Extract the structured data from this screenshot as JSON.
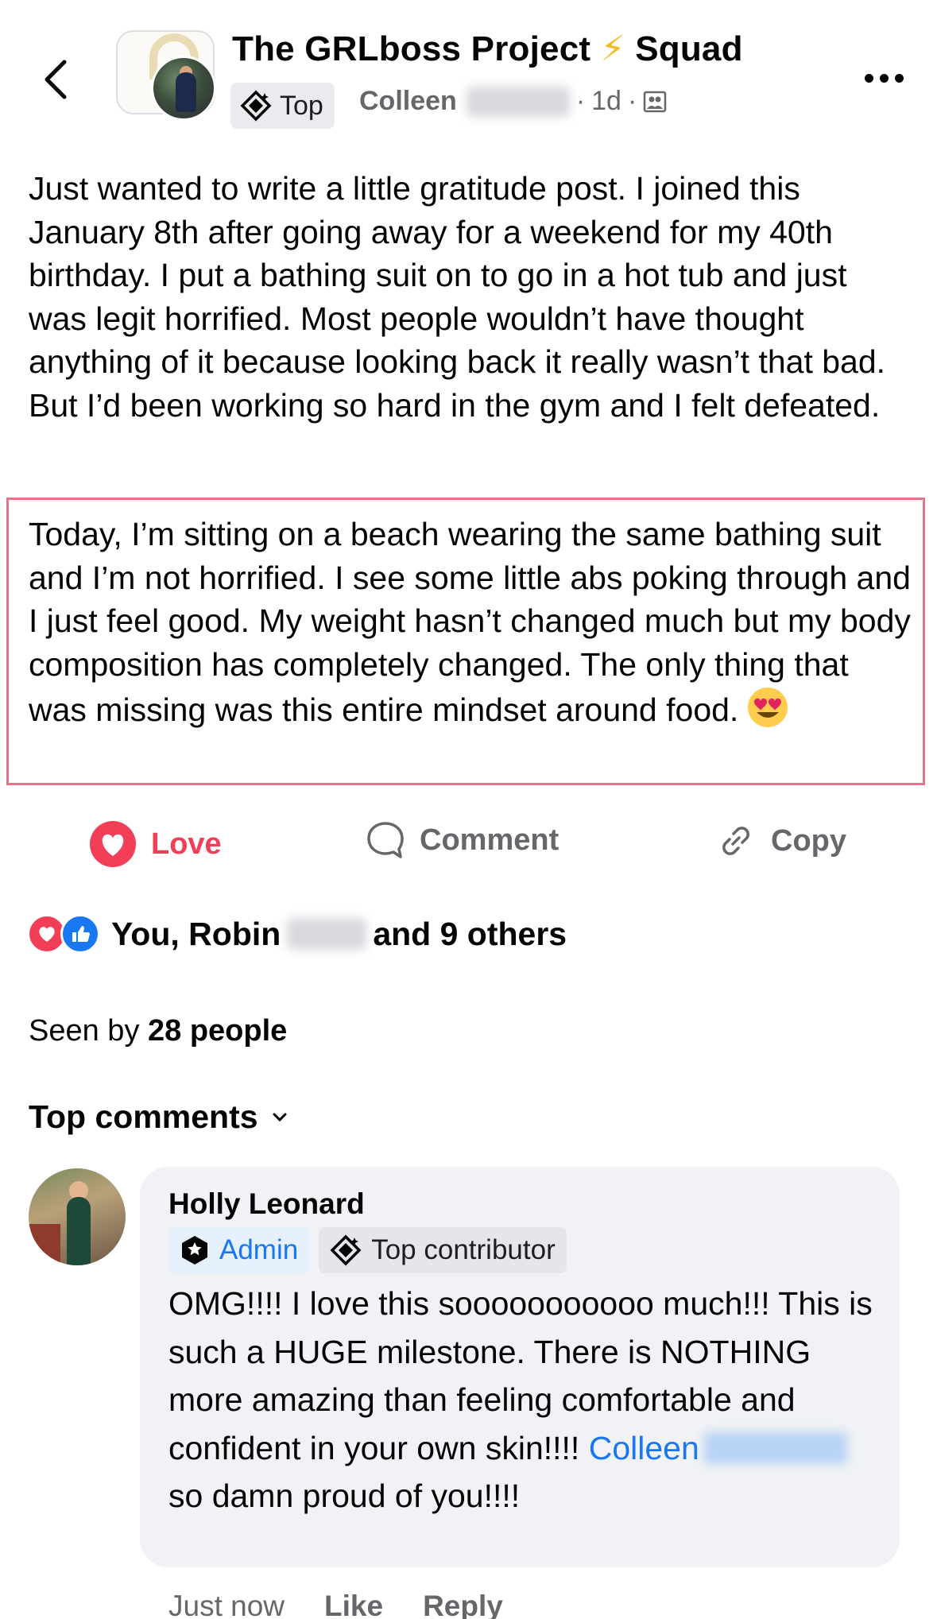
{
  "header": {
    "group_name": "The GRLboss Project",
    "group_name_bolt": "⚡",
    "group_name_suffix": "Squad",
    "badge_label": "Top",
    "author_first_name": "Colleen",
    "time": "1d",
    "separator": "·",
    "back_icon": "chevron-left-icon",
    "more_icon": "more-horizontal-icon",
    "privacy_icon": "group-privacy-icon"
  },
  "post": {
    "paragraph_1": "Just wanted to write a little gratitude post. I joined this January 8th after going away for a weekend for my 40th birthday. I put a bathing suit on to go in a hot tub and just was legit horrified. Most people wouldn’t have thought anything of it because looking back it really wasn’t that bad. But I’d been working so hard in the gym and I felt defeated.",
    "paragraph_2": "Today, I’m sitting on a beach wearing the same bathing suit and I’m not horrified. I see some little abs poking through and I just feel good. My weight hasn’t changed much but my body composition has completely changed. The only thing that was missing was this entire mindset around food.",
    "emoji": "heart-eyes-emoji",
    "highlight_color": "#e0768a"
  },
  "actions": {
    "love_label": "Love",
    "comment_label": "Comment",
    "copy_label": "Copy",
    "love_color": "#f33e58"
  },
  "reactions": {
    "prefix": "You, Robin",
    "suffix": "and 9 others"
  },
  "seen": {
    "prefix": "Seen by",
    "count": "28 people"
  },
  "comments": {
    "sort_label": "Top comments",
    "items": [
      {
        "author": "Holly Leonard",
        "badge_admin": "Admin",
        "badge_contributor": "Top contributor",
        "text_before": "OMG!!!! I love this sooooooooooo much!!! This is such a HUGE milestone. There is NOTHING more amazing than feeling comfortable and confident in your own skin!!!! ",
        "mention": "Colleen",
        "text_after": " so damn proud of you!!!!",
        "time": "Just now",
        "like_label": "Like",
        "reply_label": "Reply"
      }
    ]
  },
  "colors": {
    "link": "#1877f2",
    "secondary_text": "#65676b",
    "bubble": "#f0f2f5"
  }
}
